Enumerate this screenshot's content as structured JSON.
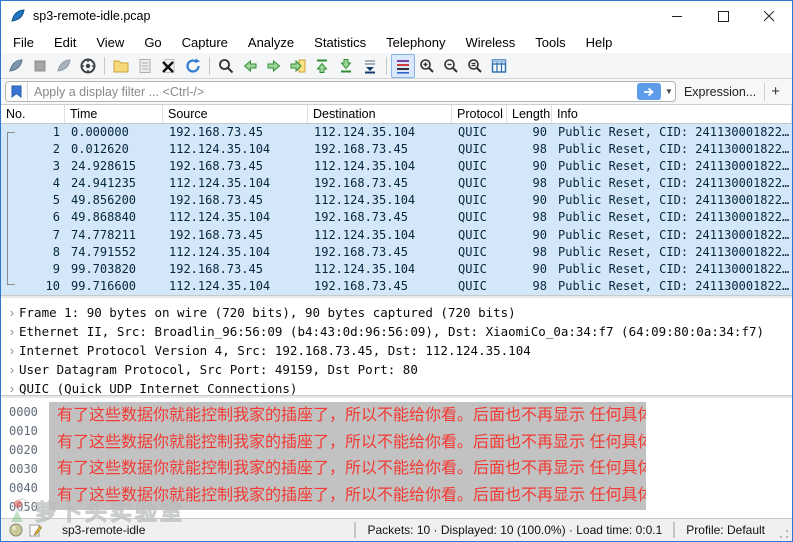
{
  "window": {
    "title": "sp3-remote-idle.pcap"
  },
  "menu_bar": {
    "items": [
      "File",
      "Edit",
      "View",
      "Go",
      "Capture",
      "Analyze",
      "Statistics",
      "Telephony",
      "Wireless",
      "Tools",
      "Help"
    ]
  },
  "toolbar": {
    "icons": [
      "start-capture",
      "stop-capture",
      "restart-capture",
      "capture-options",
      "open-file",
      "save-file",
      "close-file",
      "reload-file",
      "find-packet",
      "go-back",
      "go-forward",
      "go-to-packet",
      "go-to-top",
      "go-to-bottom",
      "auto-scroll",
      "colorize-packets",
      "zoom-in",
      "zoom-out",
      "zoom-reset",
      "resize-columns"
    ]
  },
  "filter_bar": {
    "placeholder": "Apply a display filter ... <Ctrl-/>",
    "expression_label": "Expression...",
    "add_button": "+"
  },
  "packet_list": {
    "columns": [
      "No.",
      "Time",
      "Source",
      "Destination",
      "Protocol",
      "Length",
      "Info"
    ],
    "selected_row": 1,
    "rows": [
      [
        "1",
        "0.000000",
        "192.168.73.45",
        "112.124.35.104",
        "QUIC",
        "90",
        "Public Reset, CID: 241130001822…"
      ],
      [
        "2",
        "0.012620",
        "112.124.35.104",
        "192.168.73.45",
        "QUIC",
        "98",
        "Public Reset, CID: 241130001822…"
      ],
      [
        "3",
        "24.928615",
        "192.168.73.45",
        "112.124.35.104",
        "QUIC",
        "90",
        "Public Reset, CID: 241130001822…"
      ],
      [
        "4",
        "24.941235",
        "112.124.35.104",
        "192.168.73.45",
        "QUIC",
        "98",
        "Public Reset, CID: 241130001822…"
      ],
      [
        "5",
        "49.856200",
        "192.168.73.45",
        "112.124.35.104",
        "QUIC",
        "90",
        "Public Reset, CID: 241130001822…"
      ],
      [
        "6",
        "49.868840",
        "112.124.35.104",
        "192.168.73.45",
        "QUIC",
        "98",
        "Public Reset, CID: 241130001822…"
      ],
      [
        "7",
        "74.778211",
        "192.168.73.45",
        "112.124.35.104",
        "QUIC",
        "90",
        "Public Reset, CID: 241130001822…"
      ],
      [
        "8",
        "74.791552",
        "112.124.35.104",
        "192.168.73.45",
        "QUIC",
        "98",
        "Public Reset, CID: 241130001822…"
      ],
      [
        "9",
        "99.703820",
        "192.168.73.45",
        "112.124.35.104",
        "QUIC",
        "90",
        "Public Reset, CID: 241130001822…"
      ],
      [
        "10",
        "99.716600",
        "112.124.35.104",
        "192.168.73.45",
        "QUIC",
        "98",
        "Public Reset, CID: 241130001822…"
      ]
    ]
  },
  "packet_details": {
    "expander": "›",
    "lines": [
      "Frame 1: 90 bytes on wire (720 bits), 90 bytes captured (720 bits)",
      "Ethernet II, Src: Broadlin_96:56:09 (b4:43:0d:96:56:09), Dst: XiaomiCo_0a:34:f7 (64:09:80:0a:34:f7)",
      "Internet Protocol Version 4, Src: 192.168.73.45, Dst: 112.124.35.104",
      "User Datagram Protocol, Src Port: 49159, Dst Port: 80",
      "QUIC (Quick UDP Internet Connections)"
    ]
  },
  "hex_view": {
    "offsets": [
      "0000",
      "0010",
      "0020",
      "0030",
      "0040",
      "0050"
    ],
    "redacted_lines": [
      "有了这些数据你就能控制我家的插座了，所以不能给你看。后面也不再显示 任何具体数据。",
      "有了这些数据你就能控制我家的插座了，所以不能给你看。后面也不再显示 任何具体数据。",
      "有了这些数据你就能控制我家的插座了，所以不能给你看。后面也不再显示 任何具体数据。",
      "有了这些数据你就能控制我家的插座了，所以不能给你看。后面也不再显示 任何具体数据。"
    ]
  },
  "watermark": {
    "text": "萝卜头实验室"
  },
  "status_bar": {
    "filename": "sp3-remote-idle",
    "stats": "Packets: 10 · Displayed: 10 (100.0%) · Load time: 0:0.1",
    "profile": "Profile: Default"
  },
  "colors": {
    "accent_blue": "#2b77d1",
    "row_blue": "#d4e7f8",
    "redacted_red": "#f23a34",
    "hex_panel_gray": "#c2c2c2"
  }
}
